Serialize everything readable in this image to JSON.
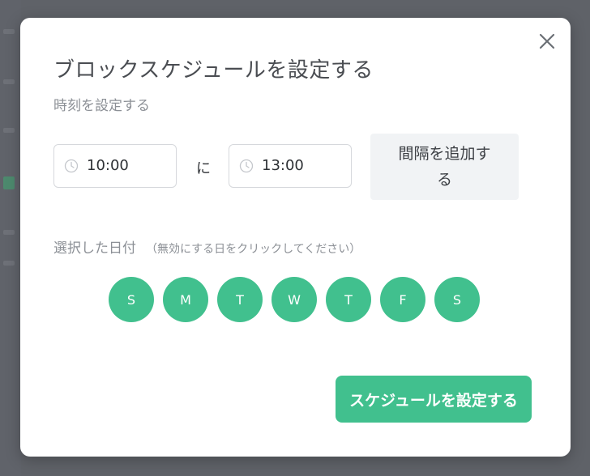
{
  "modal": {
    "title": "ブロックスケジュールを設定する",
    "subtitle": "時刻を設定する",
    "close_icon": "close-icon"
  },
  "time": {
    "start_value": "10:00",
    "separator": "に",
    "end_value": "13:00",
    "icon": "clock-icon"
  },
  "add_interval": {
    "line1": "間隔を追加す",
    "line2": "る"
  },
  "days": {
    "label": "選択した日付",
    "hint": "（無効にする日をクリックしてください）",
    "items": [
      {
        "label": "S",
        "selected": true
      },
      {
        "label": "M",
        "selected": true
      },
      {
        "label": "T",
        "selected": true
      },
      {
        "label": "W",
        "selected": true
      },
      {
        "label": "T",
        "selected": true
      },
      {
        "label": "F",
        "selected": true
      },
      {
        "label": "S",
        "selected": true
      }
    ]
  },
  "submit": {
    "label": "スケジュールを設定する"
  },
  "colors": {
    "accent": "#41c08e",
    "overlay": "#5f6268",
    "title": "#4a4d52",
    "muted": "#8c9096"
  }
}
